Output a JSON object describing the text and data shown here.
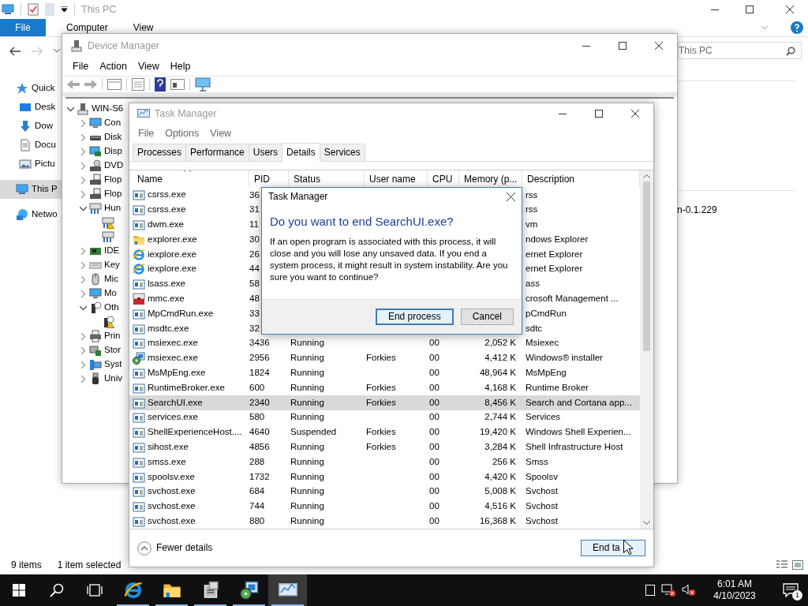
{
  "explorer": {
    "title": "This PC",
    "file_tab": "File",
    "ribbon_tabs": [
      "Computer",
      "View"
    ],
    "search": {
      "placeholder": "This PC"
    },
    "nav_items": [
      {
        "label": "Quick",
        "kind": "star",
        "selected": false,
        "children": [
          {
            "label": "Desk",
            "kind": "desktop",
            "selected": false
          },
          {
            "label": "Dow",
            "kind": "download",
            "selected": false
          },
          {
            "label": "Docu",
            "kind": "document",
            "selected": false
          },
          {
            "label": "Pictu",
            "kind": "picture",
            "selected": false
          }
        ]
      },
      {
        "label": "This P",
        "kind": "pc",
        "selected": true
      },
      {
        "label": "Netwo",
        "kind": "network",
        "selected": false
      }
    ],
    "content_text": "n-0.1.229",
    "status": {
      "items": "9 items",
      "selected": "1 item selected"
    }
  },
  "device_manager": {
    "title": "Device Manager",
    "menu": [
      "File",
      "Action",
      "View",
      "Help"
    ],
    "tree": [
      {
        "label": "WIN-S6",
        "kind": "tower",
        "expanded": true,
        "children": [
          {
            "label": "Con",
            "kind": "monitor",
            "expanded": false
          },
          {
            "label": "Disk",
            "kind": "disk",
            "expanded": false
          },
          {
            "label": "Disp",
            "kind": "card",
            "expanded": false
          },
          {
            "label": "DVD",
            "kind": "dvd",
            "expanded": false
          },
          {
            "label": "Flop",
            "kind": "floppy",
            "expanded": false
          },
          {
            "label": "Flop",
            "kind": "floppy",
            "expanded": false
          },
          {
            "label": "Hun",
            "kind": "hid",
            "expanded": true,
            "children": [
              {
                "kind": "hid",
                "warning": true
              },
              {
                "kind": "hid",
                "warning": false
              }
            ]
          },
          {
            "label": "IDE",
            "kind": "controller",
            "expanded": false
          },
          {
            "label": "Key",
            "kind": "keyboard",
            "expanded": false
          },
          {
            "label": "Mic",
            "kind": "mouse",
            "expanded": false
          },
          {
            "label": "Mo",
            "kind": "monitor",
            "expanded": false
          },
          {
            "label": "Oth",
            "kind": "unknown",
            "expanded": true,
            "children": [
              {
                "kind": "unknown",
                "warning": true
              }
            ]
          },
          {
            "label": "Prin",
            "kind": "printer",
            "expanded": false
          },
          {
            "label": "Stor",
            "kind": "storage",
            "expanded": false
          },
          {
            "label": "Syst",
            "kind": "system",
            "expanded": false
          },
          {
            "label": "Univ",
            "kind": "usb",
            "expanded": false
          }
        ]
      }
    ]
  },
  "task_manager": {
    "title": "Task Manager",
    "menu": [
      "File",
      "Options",
      "View"
    ],
    "tabs": [
      {
        "label": "Processes",
        "selected": false
      },
      {
        "label": "Performance",
        "selected": false
      },
      {
        "label": "Users",
        "selected": false
      },
      {
        "label": "Details",
        "selected": true
      },
      {
        "label": "Services",
        "selected": false
      }
    ],
    "columns": [
      "Name",
      "PID",
      "Status",
      "User name",
      "CPU",
      "Memory (p...",
      "Description"
    ],
    "rows": [
      {
        "name": "csrss.exe",
        "kind": "app",
        "pid": "36",
        "description": "rss",
        "selected": false
      },
      {
        "name": "csrss.exe",
        "kind": "app",
        "pid": "31",
        "description": "rss",
        "selected": false
      },
      {
        "name": "dwm.exe",
        "kind": "app",
        "pid": "11",
        "description": "vm",
        "selected": false
      },
      {
        "name": "explorer.exe",
        "kind": "folder",
        "pid": "30",
        "description": "ndows Explorer",
        "selected": false
      },
      {
        "name": "iexplore.exe",
        "kind": "ie",
        "pid": "26",
        "description": "ernet Explorer",
        "selected": false
      },
      {
        "name": "iexplore.exe",
        "kind": "ie",
        "pid": "44",
        "description": "ernet Explorer",
        "selected": false
      },
      {
        "name": "lsass.exe",
        "kind": "app",
        "pid": "58",
        "description": "ass",
        "selected": false
      },
      {
        "name": "mmc.exe",
        "kind": "mmc",
        "pid": "48",
        "description": "crosoft Management ...",
        "selected": false
      },
      {
        "name": "MpCmdRun.exe",
        "kind": "app",
        "pid": "33",
        "description": "pCmdRun",
        "selected": false
      },
      {
        "name": "msdtc.exe",
        "kind": "app",
        "pid": "32",
        "description": "sdtc",
        "selected": false
      },
      {
        "name": "msiexec.exe",
        "kind": "app",
        "pid": "3436",
        "status": "Running",
        "cpu": "00",
        "memory": "2,052 K",
        "description": "Msiexec",
        "selected": false
      },
      {
        "name": "msiexec.exe",
        "kind": "installer",
        "pid": "2956",
        "status": "Running",
        "user": "Forkies",
        "cpu": "00",
        "memory": "4,412 K",
        "description": "Windows® installer",
        "selected": false
      },
      {
        "name": "MsMpEng.exe",
        "kind": "app",
        "pid": "1824",
        "status": "Running",
        "cpu": "00",
        "memory": "48,964 K",
        "description": "MsMpEng",
        "selected": false
      },
      {
        "name": "RuntimeBroker.exe",
        "kind": "app",
        "pid": "600",
        "status": "Running",
        "user": "Forkies",
        "cpu": "00",
        "memory": "4,168 K",
        "description": "Runtime Broker",
        "selected": false
      },
      {
        "name": "SearchUI.exe",
        "kind": "app",
        "pid": "2340",
        "status": "Running",
        "user": "Forkies",
        "cpu": "00",
        "memory": "8,456 K",
        "description": "Search and Cortana app...",
        "selected": true
      },
      {
        "name": "services.exe",
        "kind": "app",
        "pid": "580",
        "status": "Running",
        "cpu": "00",
        "memory": "2,744 K",
        "description": "Services",
        "selected": false
      },
      {
        "name": "ShellExperienceHost....",
        "kind": "app",
        "pid": "4640",
        "status": "Suspended",
        "user": "Forkies",
        "cpu": "00",
        "memory": "19,420 K",
        "description": "Windows Shell Experien...",
        "selected": false
      },
      {
        "name": "sihost.exe",
        "kind": "app",
        "pid": "4856",
        "status": "Running",
        "user": "Forkies",
        "cpu": "00",
        "memory": "3,284 K",
        "description": "Shell Infrastructure Host",
        "selected": false
      },
      {
        "name": "smss.exe",
        "kind": "app",
        "pid": "288",
        "status": "Running",
        "cpu": "00",
        "memory": "256 K",
        "description": "Smss",
        "selected": false
      },
      {
        "name": "spoolsv.exe",
        "kind": "app",
        "pid": "1732",
        "status": "Running",
        "cpu": "00",
        "memory": "4,420 K",
        "description": "Spoolsv",
        "selected": false
      },
      {
        "name": "svchost.exe",
        "kind": "app",
        "pid": "684",
        "status": "Running",
        "cpu": "00",
        "memory": "5,008 K",
        "description": "Svchost",
        "selected": false
      },
      {
        "name": "svchost.exe",
        "kind": "app",
        "pid": "744",
        "status": "Running",
        "cpu": "00",
        "memory": "4,516 K",
        "description": "Svchost",
        "selected": false
      },
      {
        "name": "svchost.exe",
        "kind": "app",
        "pid": "880",
        "status": "Running",
        "cpu": "00",
        "memory": "16,368 K",
        "description": "Svchost",
        "selected": false
      }
    ],
    "fewer_details": "Fewer details",
    "end_task": "End ta"
  },
  "dialog": {
    "title": "Task Manager",
    "heading": "Do you want to end SearchUI.exe?",
    "message": "If an open program is associated with this process, it will close and you will lose any unsaved data. If you end a system process, it might result in system instability. Are you sure you want to continue?",
    "buttons": [
      {
        "label": "End process",
        "default": true
      },
      {
        "label": "Cancel",
        "default": false
      }
    ]
  },
  "taskbar": {
    "apps": [
      {
        "kind": "ie",
        "active": false
      },
      {
        "kind": "folder",
        "active": false
      },
      {
        "kind": "server",
        "active": false
      },
      {
        "kind": "installer",
        "active": false
      },
      {
        "kind": "taskmgr",
        "active": true
      }
    ],
    "time": "6:01 AM",
    "date": "4/10/2023",
    "notifications": "1"
  }
}
